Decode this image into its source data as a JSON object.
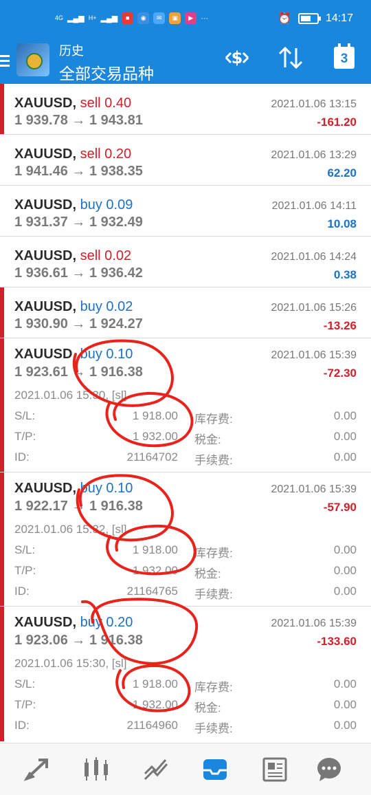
{
  "status_bar": {
    "network1": "4G",
    "network2": "H+",
    "time": "14:17",
    "app_icons": [
      "RED",
      "blue",
      "msg",
      "NFC",
      "video"
    ]
  },
  "app_bar": {
    "subtitle": "历史",
    "title": "全部交易品种",
    "calendar_day": "3"
  },
  "trades": [
    {
      "symbol": "XAUUSD,",
      "side": "sell",
      "volume": "0.40",
      "open_price": "1 939.78",
      "close_price": "1 943.81",
      "arrow": "→",
      "time": "2021.01.06 13:15",
      "profit": "-161.20",
      "loss": true
    },
    {
      "symbol": "XAUUSD,",
      "side": "sell",
      "volume": "0.20",
      "open_price": "1 941.46",
      "close_price": "1 938.35",
      "arrow": "→",
      "time": "2021.01.06 13:29",
      "profit": "62.20",
      "loss": false
    },
    {
      "symbol": "XAUUSD,",
      "side": "buy",
      "volume": "0.09",
      "open_price": "1 931.37",
      "close_price": "1 932.49",
      "arrow": "→",
      "time": "2021.01.06 14:11",
      "profit": "10.08",
      "loss": false
    },
    {
      "symbol": "XAUUSD,",
      "side": "sell",
      "volume": "0.02",
      "open_price": "1 936.61",
      "close_price": "1 936.42",
      "arrow": "→",
      "time": "2021.01.06 14:24",
      "profit": "0.38",
      "loss": false
    },
    {
      "symbol": "XAUUSD,",
      "side": "buy",
      "volume": "0.02",
      "open_price": "1 930.90",
      "close_price": "1 924.27",
      "arrow": "→",
      "time": "2021.01.06 15:26",
      "profit": "-13.26",
      "loss": true
    }
  ],
  "expanded_trades": [
    {
      "symbol": "XAUUSD,",
      "side": "buy",
      "volume": "0.10",
      "open_price": "1 923.61",
      "close_price": "1 916.38",
      "arrow": "→",
      "time": "2021.01.06 15:39",
      "profit": "-72.30",
      "open_time": "2021.01.06 15:30, [sl]",
      "sl_label": "S/L:",
      "sl": "1 918.00",
      "tp_label": "T/P:",
      "tp": "1 932.00",
      "id_label": "ID:",
      "id": "21164702",
      "swap_label": "库存费:",
      "swap": "0.00",
      "tax_label": "税金:",
      "tax": "0.00",
      "commission_label": "手续费:",
      "commission": "0.00"
    },
    {
      "symbol": "XAUUSD,",
      "side": "buy",
      "volume": "0.10",
      "open_price": "1 922.17",
      "close_price": "1 916.38",
      "arrow": "→",
      "time": "2021.01.06 15:39",
      "profit": "-57.90",
      "open_time": "2021.01.06 15:32, [sl]",
      "sl_label": "S/L:",
      "sl": "1 918.00",
      "tp_label": "T/P:",
      "tp": "1 932.00",
      "id_label": "ID:",
      "id": "21164765",
      "swap_label": "库存费:",
      "swap": "0.00",
      "tax_label": "税金:",
      "tax": "0.00",
      "commission_label": "手续费:",
      "commission": "0.00"
    },
    {
      "symbol": "XAUUSD,",
      "side": "buy",
      "volume": "0.20",
      "open_price": "1 923.06",
      "close_price": "1 916.38",
      "arrow": "→",
      "time": "2021.01.06 15:39",
      "profit": "-133.60",
      "open_time": "2021.01.06 15:30, [sl]",
      "sl_label": "S/L:",
      "sl": "1 918.00",
      "tp_label": "T/P:",
      "tp": "1 932.00",
      "id_label": "ID:",
      "id": "21164960",
      "swap_label": "库存费:",
      "swap": "0.00",
      "tax_label": "税金:",
      "tax": "0.00",
      "commission_label": "手续费:",
      "commission": "0.00"
    }
  ],
  "bottom_nav": [
    "quotes-icon",
    "chart-icon",
    "trade-icon",
    "history-icon",
    "news-icon",
    "chat-icon"
  ],
  "colors": {
    "accent": "#1b87dc",
    "loss": "#d1202b",
    "profit": "#1a72c9",
    "annotation": "#e8231c"
  }
}
